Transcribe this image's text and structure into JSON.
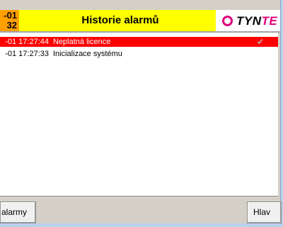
{
  "header": {
    "date": "-01",
    "time": "32",
    "title": "Historie alarmů",
    "logo_text_main": "TYN",
    "logo_text_accent": "TE"
  },
  "alarms": [
    {
      "time": "-01 17:27:44",
      "message": "Neplatná licence",
      "acknowledged_icon": "checkmark-icon",
      "active": true
    },
    {
      "time": "-01 17:27:33",
      "message": "Inicializace systému",
      "active": false
    }
  ],
  "footer": {
    "left_button_label": "i alarmy",
    "right_button_label": "Hlav"
  },
  "colors": {
    "header_bg": "#ffff00",
    "datetime_bg": "#ff9f00",
    "active_alarm_bg": "#ff0000",
    "logo_accent": "#e0007a"
  }
}
